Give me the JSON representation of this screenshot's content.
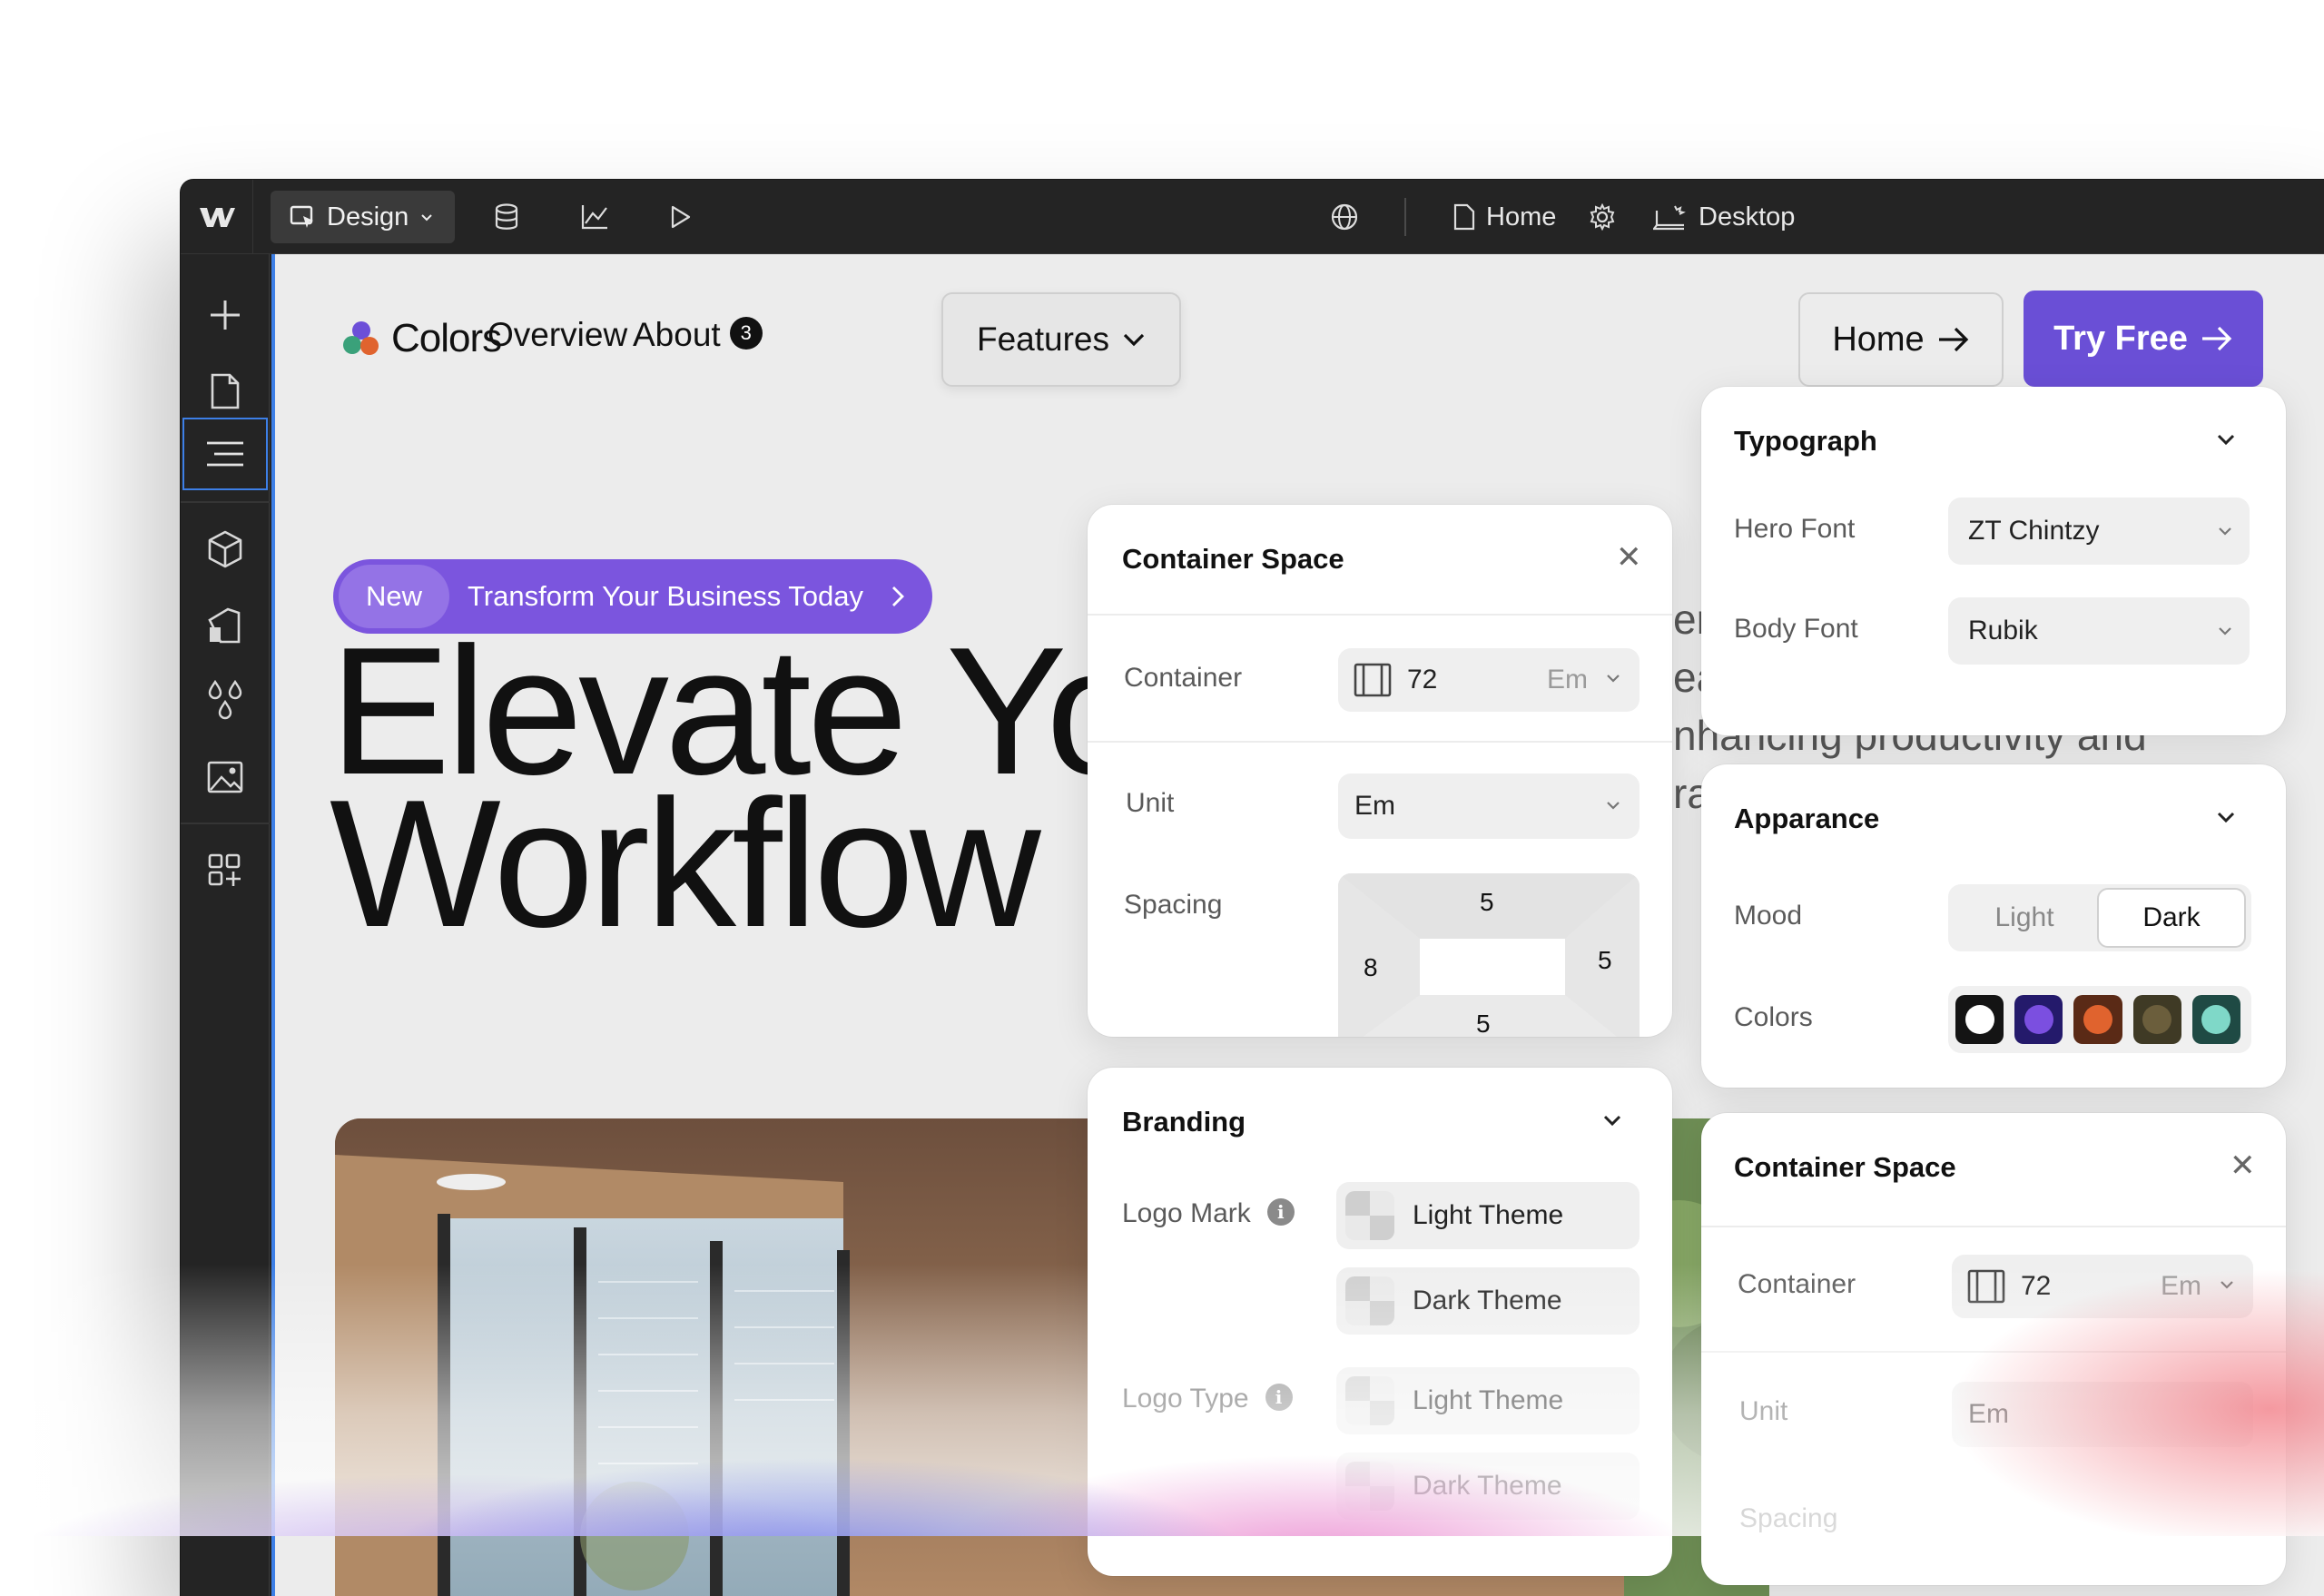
{
  "topbar": {
    "mode_label": "Design",
    "page_label": "Home",
    "breakpoint_label": "Desktop"
  },
  "site": {
    "brand": "Colors",
    "nav": {
      "overview": "Overview",
      "about": "About",
      "about_badge": "3",
      "features": "Features",
      "home_button": "Home",
      "try_button": "Try Free"
    },
    "announcement": {
      "tag": "New",
      "text": "Transform Your Business Today"
    },
    "hero_line1": "Elevate Yo",
    "hero_line2": "Workflow",
    "side_text": [
      "er",
      "ea",
      "nhancing productivity and",
      "ra"
    ]
  },
  "container_panel": {
    "title": "Container Space",
    "container_label": "Container",
    "container_value": "72",
    "container_unit": "Em",
    "unit_label": "Unit",
    "unit_value": "Em",
    "spacing_label": "Spacing",
    "spacing": {
      "top": "5",
      "right": "5",
      "bottom": "5",
      "left": "8"
    }
  },
  "branding_panel": {
    "title": "Branding",
    "logo_mark_label": "Logo Mark",
    "logo_mark_info": "i",
    "logo_mark_options": [
      "Light Theme",
      "Dark Theme"
    ],
    "logo_type_label": "Logo Type",
    "logo_type_info": "i",
    "logo_type_options": [
      "Light Theme",
      "Dark Theme"
    ]
  },
  "typography_panel": {
    "title": "Typograph",
    "hero_font_label": "Hero Font",
    "hero_font_value": "ZT Chintzy",
    "body_font_label": "Body Font",
    "body_font_value": "Rubik"
  },
  "appearance_panel": {
    "title": "Apparance",
    "mood_label": "Mood",
    "mood_options": [
      "Light",
      "Dark"
    ],
    "mood_selected": "Dark",
    "colors_label": "Colors",
    "colors": [
      "#ffffff",
      "#7b4fe0",
      "#e0632e",
      "#6b5e3c",
      "#7fd8c8"
    ]
  },
  "container_panel_2": {
    "title": "Container Space",
    "container_label": "Container",
    "container_value": "72",
    "container_unit": "Em",
    "unit_label": "Unit",
    "unit_value": "Em",
    "spacing_label": "Spacing"
  }
}
